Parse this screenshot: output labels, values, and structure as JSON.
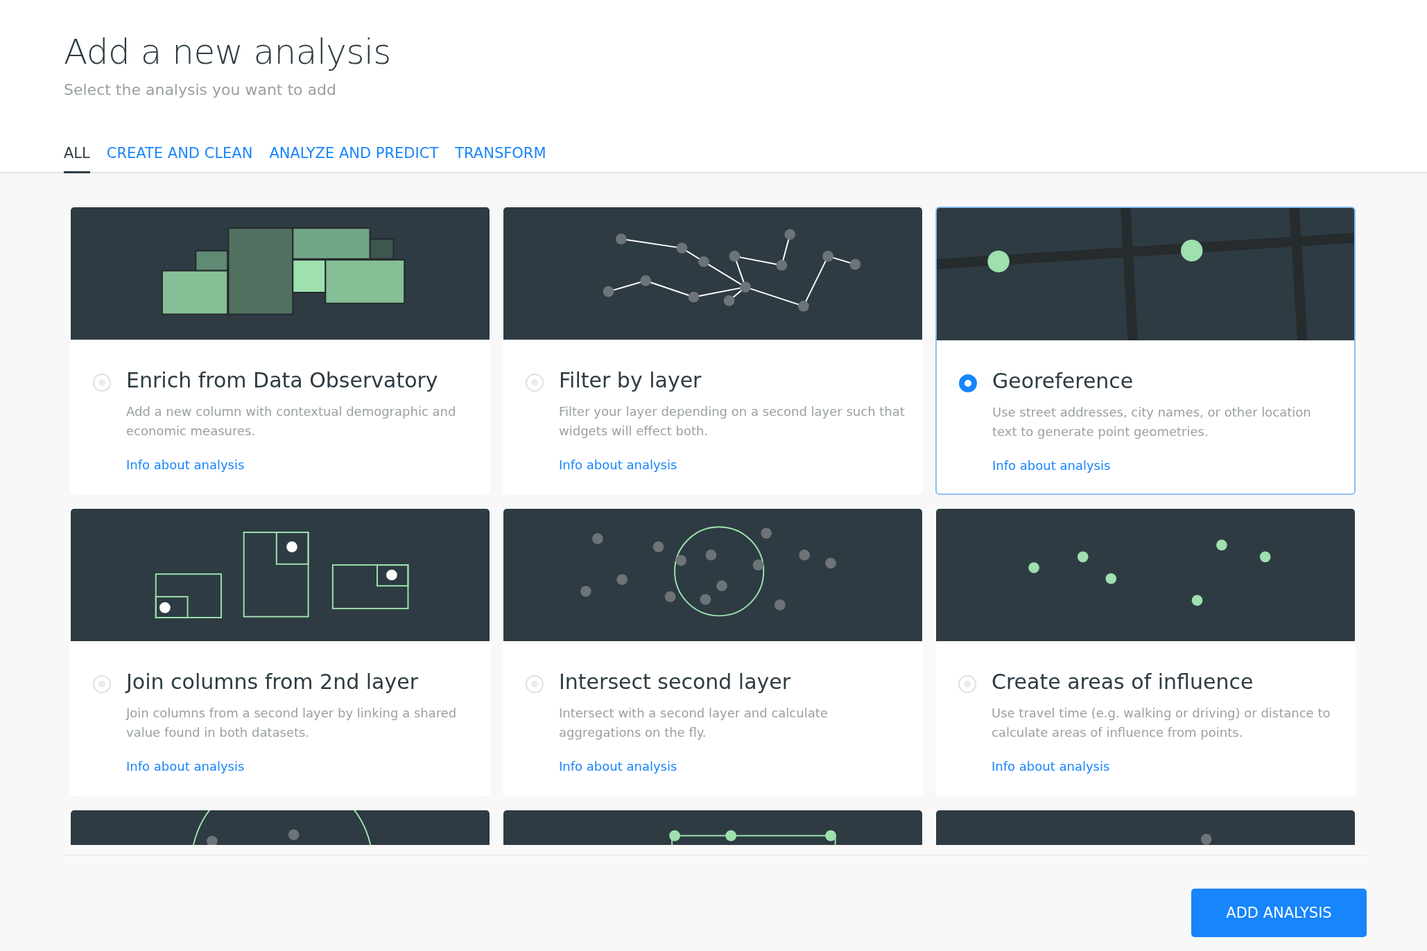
{
  "header": {
    "title": "Add a new analysis",
    "subtitle": "Select the analysis you want to add"
  },
  "tabs": [
    {
      "label": "ALL",
      "selected": true
    },
    {
      "label": "CREATE AND CLEAN",
      "selected": false
    },
    {
      "label": "ANALYZE AND PREDICT",
      "selected": false
    },
    {
      "label": "TRANSFORM",
      "selected": false
    }
  ],
  "cards": [
    {
      "kind": "blocks",
      "title": "Enrich from Data Observatory",
      "description": "Add a new column with contextual demographic and economic measures.",
      "link": "Info about analysis",
      "selected": false
    },
    {
      "kind": "network",
      "title": "Filter by layer",
      "description": "Filter your layer depending on a second layer such that widgets will effect both.",
      "link": "Info about analysis",
      "selected": false
    },
    {
      "kind": "streets",
      "title": "Georeference",
      "description": "Use street addresses, city names, or other location text to generate point geometries.",
      "link": "Info about analysis",
      "selected": true
    },
    {
      "kind": "join",
      "title": "Join columns from 2nd layer",
      "description": "Join columns from a second layer by linking a shared value found in both datasets.",
      "link": "Info about analysis",
      "selected": false
    },
    {
      "kind": "intersect",
      "title": "Intersect second layer",
      "description": "Intersect with a second layer and calculate aggregations on the fly.",
      "link": "Info about analysis",
      "selected": false
    },
    {
      "kind": "points",
      "title": "Create areas of influence",
      "description": "Use travel time (e.g. walking or driving) or distance to calculate areas of influence from points.",
      "link": "Info about analysis",
      "selected": false
    },
    {
      "kind": "buffer"
    },
    {
      "kind": "range"
    },
    {
      "kind": "dot"
    }
  ],
  "footer": {
    "button": "ADD ANALYSIS"
  }
}
